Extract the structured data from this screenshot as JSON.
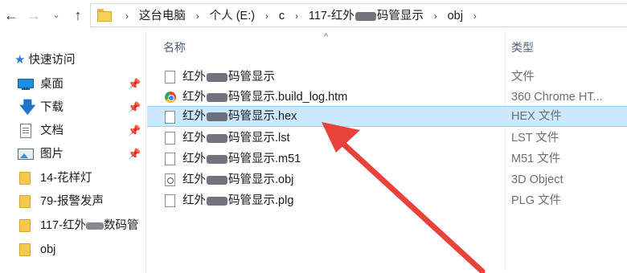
{
  "address": {
    "crumbs": [
      {
        "label": "这台电脑"
      },
      {
        "label": "个人 (E:)"
      },
      {
        "label": "c"
      },
      {
        "label_pre": "117-红外",
        "label_post": "码管显示"
      },
      {
        "label": "obj"
      }
    ]
  },
  "sidebar": {
    "quick_access": "快速访问",
    "items": [
      {
        "label": "桌面",
        "icon": "desktop-icon",
        "pinned": true
      },
      {
        "label": "下载",
        "icon": "download-icon",
        "pinned": true
      },
      {
        "label": "文档",
        "icon": "documents-icon",
        "pinned": true
      },
      {
        "label": "图片",
        "icon": "pictures-icon",
        "pinned": true
      },
      {
        "label": "14-花样灯",
        "icon": "folder-icon"
      },
      {
        "label": "79-报警发声",
        "icon": "folder-icon"
      },
      {
        "label_pre": "117-红外",
        "label_post": "数码管",
        "icon": "folder-icon"
      },
      {
        "label": "obj",
        "icon": "folder-icon"
      }
    ]
  },
  "columns": {
    "name": "名称",
    "type": "类型"
  },
  "files": [
    {
      "prefix": "红外",
      "suffix": "码管显示",
      "type": "文件",
      "icon": "file-icon"
    },
    {
      "prefix": "红外",
      "suffix": "码管显示.build_log.htm",
      "type": "360 Chrome HT...",
      "icon": "browser-icon"
    },
    {
      "prefix": "红外",
      "suffix": "码管显示.hex",
      "type": "HEX 文件",
      "icon": "file-icon",
      "selected": true
    },
    {
      "prefix": "红外",
      "suffix": "码管显示.lst",
      "type": "LST 文件",
      "icon": "file-icon"
    },
    {
      "prefix": "红外",
      "suffix": "码管显示.m51",
      "type": "M51 文件",
      "icon": "file-icon"
    },
    {
      "prefix": "红外",
      "suffix": "码管显示.obj",
      "type": "3D Object",
      "icon": "3d-object-icon"
    },
    {
      "prefix": "红外",
      "suffix": "码管显示.plg",
      "type": "PLG 文件",
      "icon": "file-icon"
    }
  ],
  "annotation": {
    "color": "#e8433a"
  }
}
